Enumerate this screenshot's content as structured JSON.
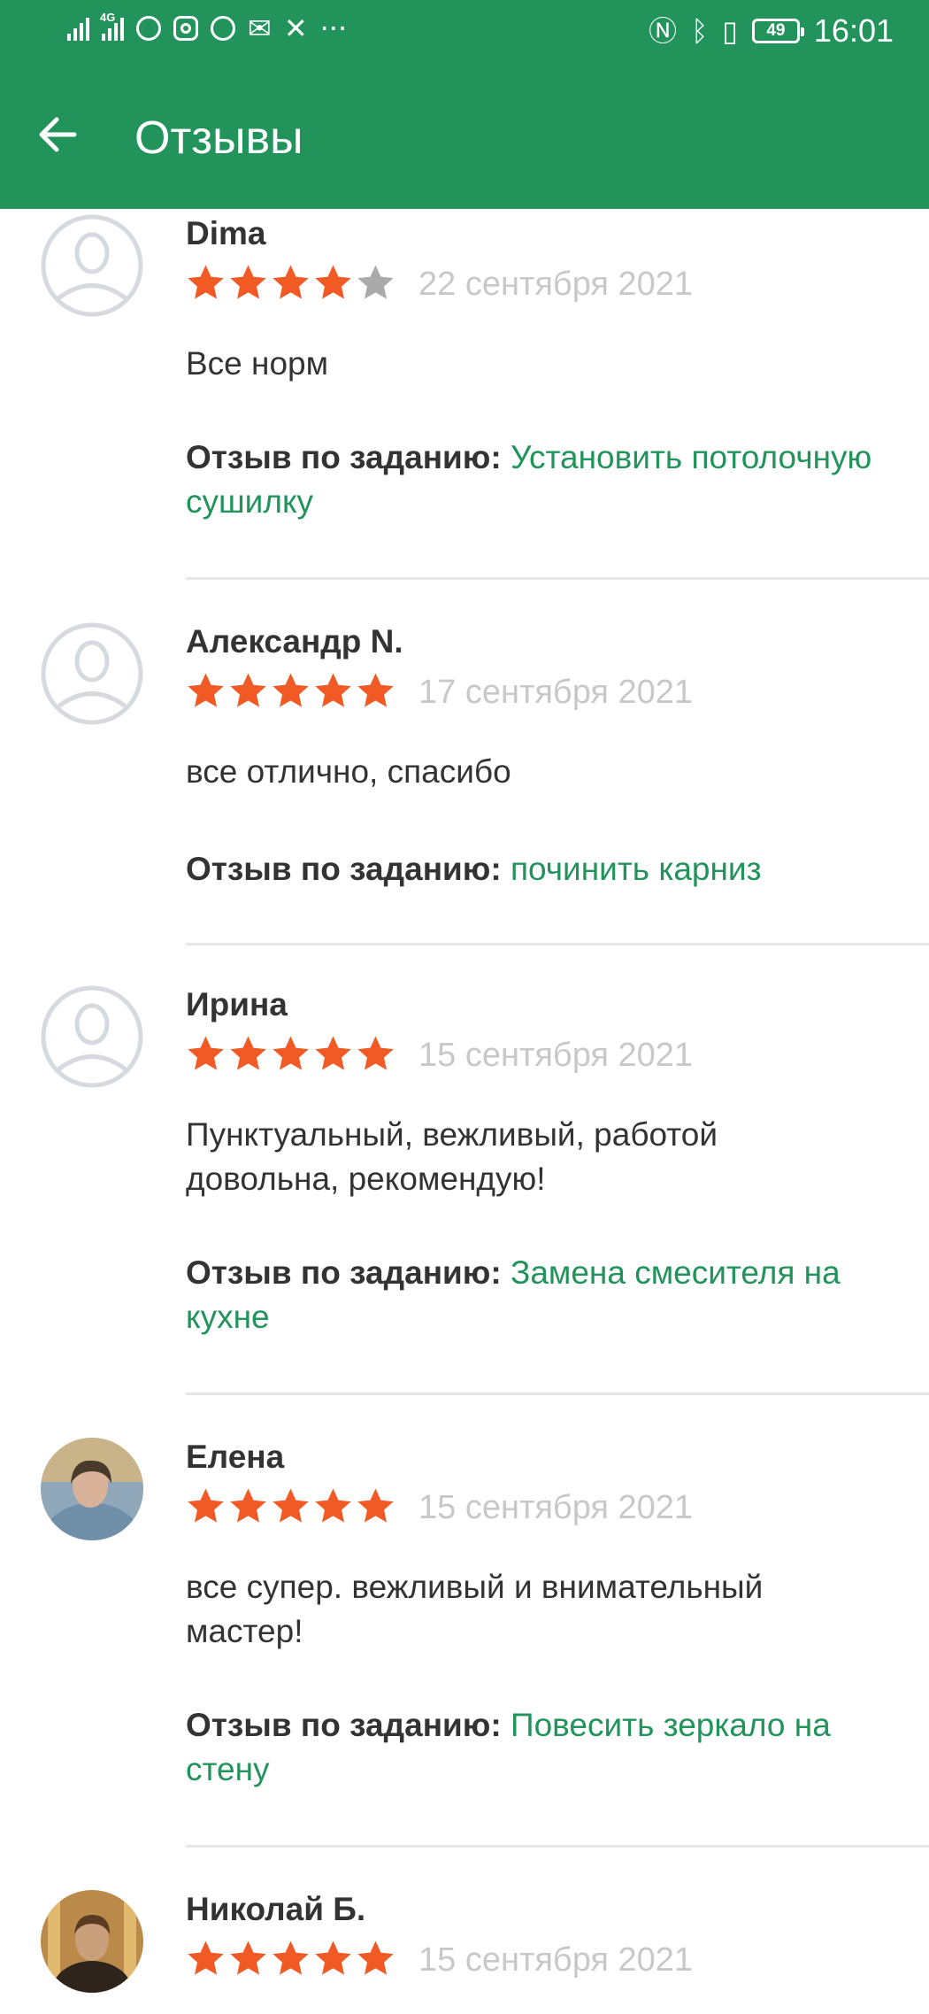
{
  "status_bar": {
    "network": "4G",
    "battery": "49",
    "time": "16:01",
    "more": "···"
  },
  "header": {
    "title": "Отзывы",
    "back_icon": "arrow-left-icon",
    "color": "#21935b"
  },
  "colors": {
    "star_filled": "#f15a24",
    "star_empty": "#aaaaaa",
    "link": "#21935b",
    "date": "#c8c8c8"
  },
  "task_label": "Отзыв по заданию:",
  "reviews": [
    {
      "name": "Dima",
      "rating": 4,
      "date": "22 сентября 2021",
      "text": "Все норм",
      "task": "Установить потолочную сушилку",
      "avatar": "placeholder"
    },
    {
      "name": "Александр N.",
      "rating": 5,
      "date": "17 сентября 2021",
      "text": "все отлично, спасибо",
      "task": "починить карниз",
      "avatar": "placeholder"
    },
    {
      "name": "Ирина",
      "rating": 5,
      "date": "15 сентября 2021",
      "text": "Пунктуальный, вежливый, работой довольна, рекомендую!",
      "task": "Замена смесителя на кухне",
      "avatar": "placeholder"
    },
    {
      "name": "Елена",
      "rating": 5,
      "date": "15 сентября 2021",
      "text": "все супер. вежливый и внимательный мастер!",
      "task": "Повесить зеркало на стену",
      "avatar": "photo"
    },
    {
      "name": "Николай Б.",
      "rating": 5,
      "date": "15 сентября 2021",
      "avatar": "photo"
    }
  ]
}
